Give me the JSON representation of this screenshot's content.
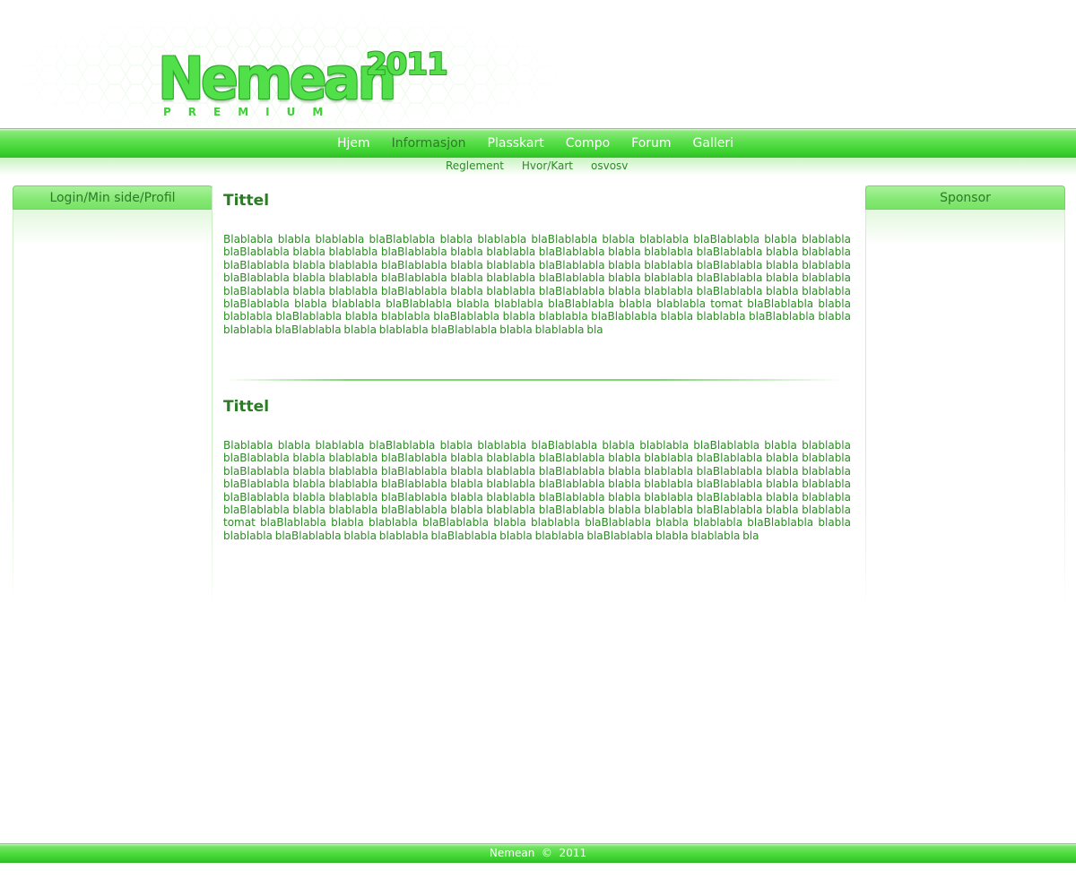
{
  "header": {
    "logo_text": "Nemean",
    "logo_year": "2011",
    "logo_sub": "PREMIUM"
  },
  "nav": {
    "items": [
      {
        "label": "Hjem"
      },
      {
        "label": "Informasjon"
      },
      {
        "label": "Plasskart"
      },
      {
        "label": "Compo"
      },
      {
        "label": "Forum"
      },
      {
        "label": "Galleri"
      }
    ],
    "active": "Informasjon"
  },
  "subnav": {
    "items": [
      {
        "label": "Reglement"
      },
      {
        "label": "Hvor/Kart"
      },
      {
        "label": "osvosv"
      }
    ]
  },
  "sidebar_left": {
    "title": "Login/Min side/Profil"
  },
  "sidebar_right": {
    "title": "Sponsor"
  },
  "articles": [
    {
      "title": "Tittel",
      "body": "Blablabla blabla blablabla blaBlablabla blabla blablabla blaBlablabla blabla blablabla blaBlablabla blabla blablabla blaBlablabla blabla blablabla blaBlablabla blabla blablabla blaBlablabla blabla blablabla blaBlablabla blabla blablabla blaBlablabla blabla blablabla blaBlablabla blabla blablabla blaBlablabla blabla blablabla blaBlablabla blabla blablabla blaBlablabla blabla blablabla blaBlablabla blabla blablabla blaBlablabla blabla blablabla blaBlablabla blabla blablabla blaBlablabla blabla blablabla blaBlablabla blabla blablabla blaBlablabla blabla blablabla blaBlablabla blabla blablabla blaBlablabla blabla blablabla blaBlablabla blabla blablabla blaBlablabla blabla blablabla tomat blaBlablabla blabla blablabla blaBlablabla blabla blablabla blaBlablabla blabla blablabla blaBlablabla blabla blablabla blaBlablabla blabla blablabla blaBlablabla blabla blablabla blaBlablabla blabla blablabla bla"
    },
    {
      "title": "Tittel",
      "body": "Blablabla blabla blablabla blaBlablabla blabla blablabla blaBlablabla blabla blablabla blaBlablabla blabla blablabla blaBlablabla blabla blablabla blaBlablabla blabla blablabla blaBlablabla blabla blablabla blaBlablabla blabla blablabla blaBlablabla blabla blablabla blaBlablabla blabla blablabla blaBlablabla blabla blablabla blaBlablabla blabla blablabla blaBlablabla blabla blablabla blaBlablabla blabla blablabla blaBlablabla blabla blablabla blaBlablabla blabla blablabla blaBlablabla blabla blablabla blaBlablabla blabla blablabla blaBlablabla blabla blablabla blaBlablabla blabla blablabla blaBlablabla blabla blablabla blaBlablabla blabla blablabla blaBlablabla blabla blablabla blaBlablabla blabla blablabla tomat blaBlablabla blabla blablabla blaBlablabla blabla blablabla blaBlablabla blabla blablabla blaBlablabla blabla blablabla blaBlablabla blabla blablabla blaBlablabla blabla blablabla blaBlablabla blabla blablabla bla"
    }
  ],
  "footer": {
    "text": "Nemean  ©  2011"
  },
  "colors": {
    "brand_green": "#4fdc40",
    "text_green": "#2d8a25",
    "title_green": "#2d7a27"
  }
}
